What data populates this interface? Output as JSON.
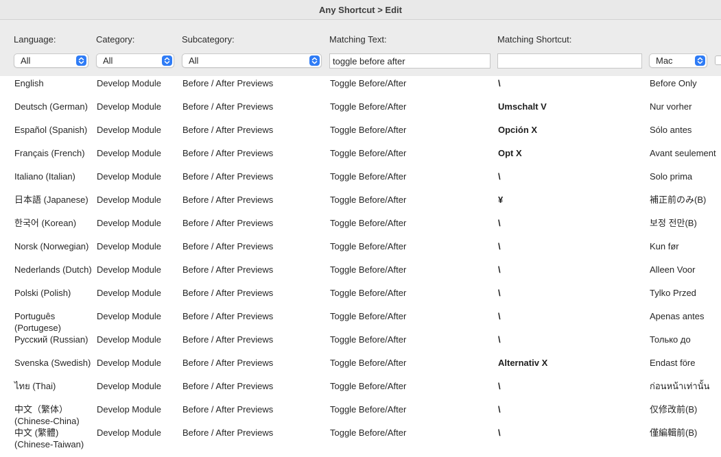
{
  "window": {
    "title": "Any Shortcut > Edit"
  },
  "filters": {
    "language": {
      "label": "Language:",
      "value": "All"
    },
    "category": {
      "label": "Category:",
      "value": "All"
    },
    "subcategory": {
      "label": "Subcategory:",
      "value": "All"
    },
    "matching_text": {
      "label": "Matching Text:",
      "value": "toggle before after"
    },
    "matching_shortcut": {
      "label": "Matching Shortcut:",
      "value": ""
    },
    "platform": {
      "value": "Mac"
    }
  },
  "colors": {
    "accent": "#2f7cf6",
    "toolbar_bg": "#ececec",
    "titlebar_bg": "#e9e9e9"
  },
  "rows": [
    {
      "language": "English",
      "category": "Develop Module",
      "subcategory": "Before / After Previews",
      "text": "Toggle Before/After",
      "shortcut": "\\",
      "action": "Before Only"
    },
    {
      "language": "Deutsch (German)",
      "category": "Develop Module",
      "subcategory": "Before / After Previews",
      "text": "Toggle Before/After",
      "shortcut": "Umschalt V",
      "action": "Nur vorher"
    },
    {
      "language": "Español (Spanish)",
      "category": "Develop Module",
      "subcategory": "Before / After Previews",
      "text": "Toggle Before/After",
      "shortcut": "Opción X",
      "action": "Sólo antes"
    },
    {
      "language": "Français (French)",
      "category": "Develop Module",
      "subcategory": "Before / After Previews",
      "text": "Toggle Before/After",
      "shortcut": "Opt X",
      "action": "Avant seulement"
    },
    {
      "language": "Italiano (Italian)",
      "category": "Develop Module",
      "subcategory": "Before / After Previews",
      "text": "Toggle Before/After",
      "shortcut": "\\",
      "action": "Solo prima"
    },
    {
      "language": "日本語 (Japanese)",
      "category": "Develop Module",
      "subcategory": "Before / After Previews",
      "text": "Toggle Before/After",
      "shortcut": "¥",
      "action": "補正前のみ(B)"
    },
    {
      "language": "한국어 (Korean)",
      "category": "Develop Module",
      "subcategory": "Before / After Previews",
      "text": "Toggle Before/After",
      "shortcut": "\\",
      "action": "보정 전만(B)"
    },
    {
      "language": "Norsk (Norwegian)",
      "category": "Develop Module",
      "subcategory": "Before / After Previews",
      "text": "Toggle Before/After",
      "shortcut": "\\",
      "action": "Kun før"
    },
    {
      "language": "Nederlands (Dutch)",
      "category": "Develop Module",
      "subcategory": "Before / After Previews",
      "text": "Toggle Before/After",
      "shortcut": "\\",
      "action": "Alleen Voor"
    },
    {
      "language": "Polski (Polish)",
      "category": "Develop Module",
      "subcategory": "Before / After Previews",
      "text": "Toggle Before/After",
      "shortcut": "\\",
      "action": "Tylko Przed"
    },
    {
      "language": "Português (Portugese)",
      "category": "Develop Module",
      "subcategory": "Before / After Previews",
      "text": "Toggle Before/After",
      "shortcut": "\\",
      "action": "Apenas antes"
    },
    {
      "language": "Русский (Russian)",
      "category": "Develop Module",
      "subcategory": "Before / After Previews",
      "text": "Toggle Before/After",
      "shortcut": "\\",
      "action": "Только до"
    },
    {
      "language": "Svenska (Swedish)",
      "category": "Develop Module",
      "subcategory": "Before / After Previews",
      "text": "Toggle Before/After",
      "shortcut": "Alternativ X",
      "action": "Endast före"
    },
    {
      "language": "ไทย (Thai)",
      "category": "Develop Module",
      "subcategory": "Before / After Previews",
      "text": "Toggle Before/After",
      "shortcut": "\\",
      "action": "ก่อนหน้าเท่านั้น"
    },
    {
      "language": "中文（繁体）(Chinese-China)",
      "category": "Develop Module",
      "subcategory": "Before / After Previews",
      "text": "Toggle Before/After",
      "shortcut": "\\",
      "action": "仅修改前(B)"
    },
    {
      "language": "中文 (繁體) (Chinese-Taiwan)",
      "category": "Develop Module",
      "subcategory": "Before / After Previews",
      "text": "Toggle Before/After",
      "shortcut": "\\",
      "action": "僅編輯前(B)"
    }
  ]
}
